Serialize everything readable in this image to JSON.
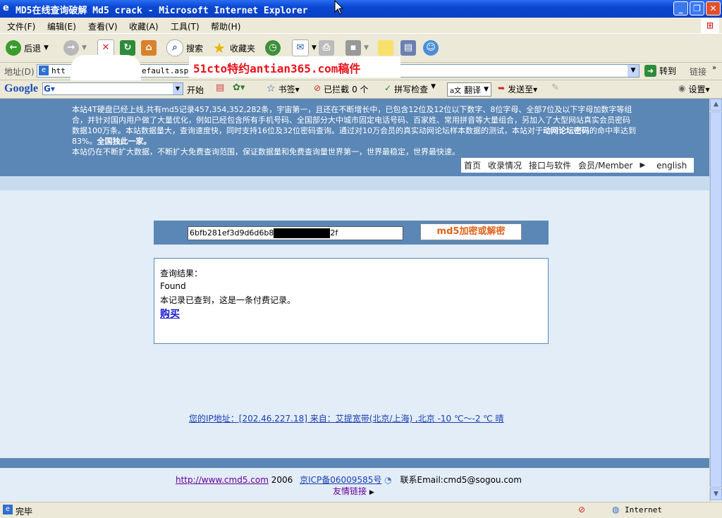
{
  "window": {
    "title": "MD5在线查询破解 Md5 crack - Microsoft Internet Explorer",
    "buttons": [
      "minimize",
      "maximize",
      "close"
    ]
  },
  "menu": [
    "文件(F)",
    "编辑(E)",
    "查看(V)",
    "收藏(A)",
    "工具(T)",
    "帮助(H)"
  ],
  "toolbar": {
    "back": "后退",
    "search": "搜索",
    "favorites": "收藏夹"
  },
  "address": {
    "label": "地址(D)",
    "url_visible_start": "htt",
    "url_visible_end": "efault.aspx",
    "go": "转到",
    "links": "链接"
  },
  "watermark": "51cto特约antian365.com稿件",
  "googlebar": {
    "logo": "Google",
    "start": "开始",
    "bookmarks": "书签▾",
    "blocked": "已拦截",
    "blocked_count": "0 个",
    "spellcheck": "拼写检查",
    "translate": "翻译",
    "sendto": "发送至▾",
    "settings": "设置▾"
  },
  "banner": {
    "line1": "本站4T硬盘已经上线,共有md5记录457,354,352,282条，宇宙第一，且还在不断增长中，已包含12位及12位以下数字、8位字母、全部7位及以下字母加数字等组合，并针对国内用户做了大量优化，例如已经包含所有手机号码、全国部分大中城市固定电话号码、百家姓、常用拼音等大量组合，另加入了大型网站真实会员密码数据100万条。本站数据量大，查询速度快，同时支持16位及32位密码查询。通过对10万会员的真实动网论坛样本数据的测试，本站对于",
    "bold1": "动网论坛密码",
    "line2": "的命中率达到83%。",
    "bold2": "全国独此一家。",
    "line3": "本站仍在不断扩大数据，不断扩大免费查询范围，保证数据量和免费查询量世界第一，世界最稳定，世界最快速。"
  },
  "nav": [
    "首页",
    "收录情况",
    "接口与软件",
    "会员/Member",
    "english"
  ],
  "query": {
    "hash_prefix": "6bfb281ef3d9d6d6b8",
    "hash_suffix": "2f",
    "button": "md5加密或解密"
  },
  "result": {
    "heading": "查询结果：",
    "status": "Found",
    "message": "本记录已查到，这是一条付费记录。",
    "buy_link": "购买"
  },
  "ipinfo": "您的IP地址：[202.46.227.18] 来自：艾提宽带(北京/上海) ,北京  -10 ℃～-2 ℃ 晴",
  "footer": {
    "site": "http://www.cmd5.com",
    "year": "2006",
    "icp": "京ICP备06009585号",
    "email": "联系Email:cmd5@sogou.com",
    "friends": "友情链接"
  },
  "status": {
    "left": "完毕",
    "zone": "Internet"
  }
}
